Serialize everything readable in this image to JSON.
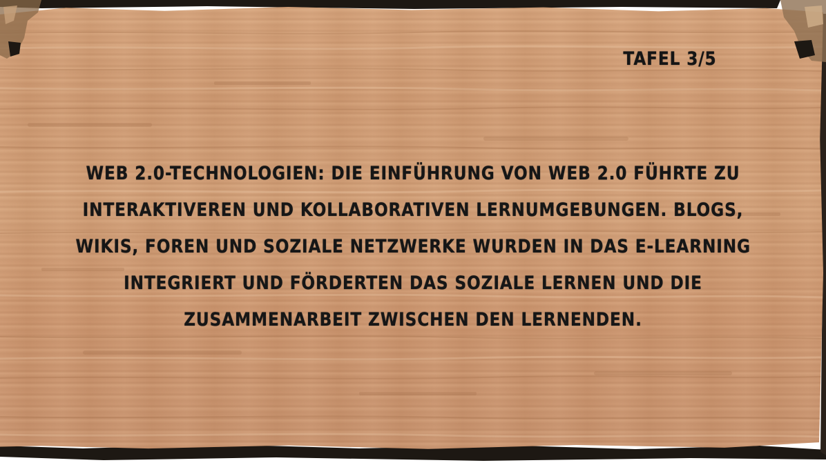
{
  "board": {
    "page_label": "TAFEL 3/5",
    "lines": [
      "WEB 2.0-TECHNOLOGIEN: DIE EINFÜHRUNG VON WEB 2.0 FÜHRTE ZU",
      "INTERAKTIVEREN UND KOLLABORATIVEN LERNUMGEBUNGEN. BLOGS,",
      "WIKIS, FOREN UND SOZIALE NETZWERKE WURDEN IN DAS E-LEARNING",
      "INTEGRIERT UND FÖRDERTEN DAS SOZIALE LERNEN UND DIE",
      "ZUSAMMENARBEIT ZWISCHEN DEN LERNENDEN."
    ]
  },
  "colors": {
    "wood": "#d2a079",
    "wood_dark": "#b07e58",
    "frame": "#1c1712",
    "text": "#161616"
  }
}
